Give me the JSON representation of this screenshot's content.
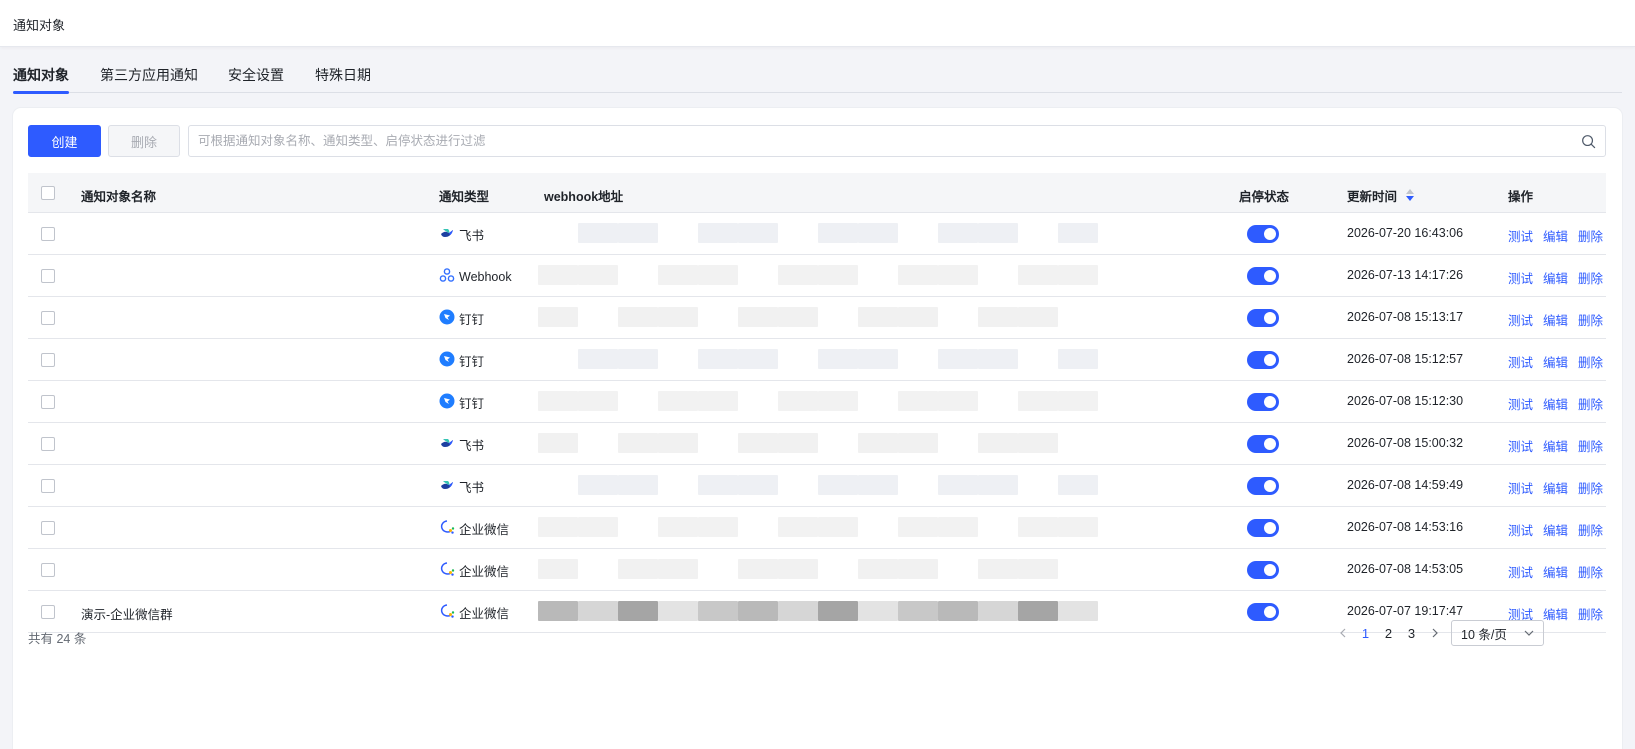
{
  "header": {
    "breadcrumb": "通知对象"
  },
  "tabs": [
    {
      "label": "通知对象",
      "active": true
    },
    {
      "label": "第三方应用通知",
      "active": false
    },
    {
      "label": "安全设置",
      "active": false
    },
    {
      "label": "特殊日期",
      "active": false
    }
  ],
  "toolbar": {
    "create_label": "创建",
    "delete_label": "删除",
    "search_placeholder": "可根据通知对象名称、通知类型、启停状态进行过滤",
    "search_value": ""
  },
  "table": {
    "columns": {
      "name": "通知对象名称",
      "type": "通知类型",
      "webhook": "webhook地址",
      "status": "启停状态",
      "updated": "更新时间",
      "actions": "操作"
    },
    "actions": {
      "test": "测试",
      "edit": "编辑",
      "delete": "删除"
    },
    "rows": [
      {
        "name": "",
        "type": "飞书",
        "type_icon": "feishu-icon",
        "status": true,
        "updated": "2026-07-20 16:43:06"
      },
      {
        "name": "",
        "type": "Webhook",
        "type_icon": "webhook-icon",
        "status": true,
        "updated": "2026-07-13 14:17:26"
      },
      {
        "name": "",
        "type": "钉钉",
        "type_icon": "dingtalk-icon",
        "status": true,
        "updated": "2026-07-08 15:13:17"
      },
      {
        "name": "",
        "type": "钉钉",
        "type_icon": "dingtalk-icon",
        "status": true,
        "updated": "2026-07-08 15:12:57"
      },
      {
        "name": "",
        "type": "钉钉",
        "type_icon": "dingtalk-icon",
        "status": true,
        "updated": "2026-07-08 15:12:30"
      },
      {
        "name": "",
        "type": "飞书",
        "type_icon": "feishu-icon",
        "status": true,
        "updated": "2026-07-08 15:00:32"
      },
      {
        "name": "",
        "type": "飞书",
        "type_icon": "feishu-icon",
        "status": true,
        "updated": "2026-07-08 14:59:49"
      },
      {
        "name": "",
        "type": "企业微信",
        "type_icon": "wecom-icon",
        "status": true,
        "updated": "2026-07-08 14:53:16"
      },
      {
        "name": "",
        "type": "企业微信",
        "type_icon": "wecom-icon",
        "status": true,
        "updated": "2026-07-08 14:53:05"
      },
      {
        "name": "演示-企业微信群",
        "type": "企业微信",
        "type_icon": "wecom-icon",
        "status": true,
        "updated": "2026-07-07 19:17:47"
      }
    ]
  },
  "footer": {
    "total": "共有 24 条",
    "pages": [
      "1",
      "2",
      "3"
    ],
    "current_page": "1",
    "page_size": "10 条/页"
  },
  "colors": {
    "primary": "#2e5bff",
    "border": "#dcdfe6",
    "muted": "#a8abb2"
  }
}
